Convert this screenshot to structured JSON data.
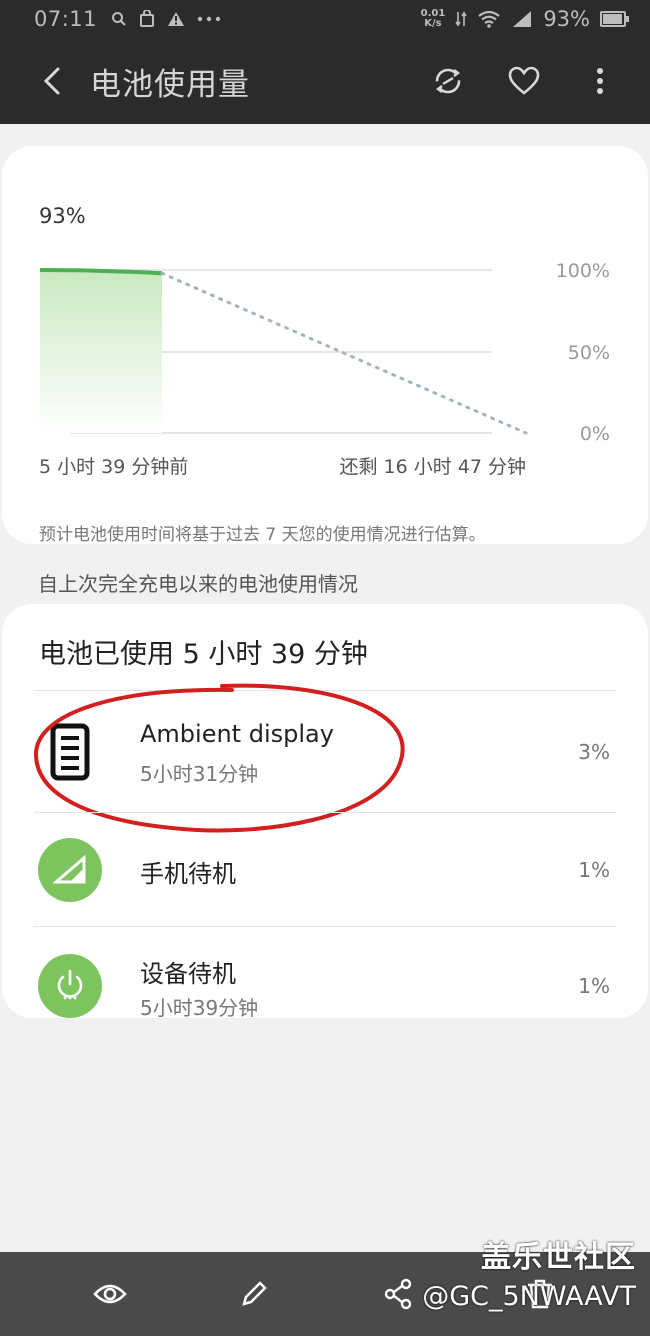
{
  "status_bar": {
    "time": "07:11",
    "speed_top": "0.01",
    "speed_bottom": "K/s",
    "battery": "93%"
  },
  "app_bar": {
    "title": "电池使用量"
  },
  "chart_card": {
    "current_percent": "93%",
    "y_ticks": [
      "100%",
      "50%",
      "0%"
    ],
    "x_left_label": "5 小时 39 分钟前",
    "x_right_label": "还剩 16 小时 47 分钟",
    "note": "预计电池使用时间将基于过去 7 天您的使用情况进行估算。"
  },
  "chart_data": {
    "type": "area",
    "y_ticks": [
      "100%",
      "50%",
      "0%"
    ],
    "ylim": [
      0,
      100
    ],
    "x_labels": [
      "5 小时 39 分钟前",
      "还剩 16 小时 47 分钟"
    ],
    "series": [
      {
        "values": [
          100,
          98
        ]
      },
      {
        "values": [
          98,
          0
        ]
      }
    ],
    "colors": {
      "actual": "#4caf50",
      "projection": "#a5b4bb",
      "fill": "#d6edd0"
    }
  },
  "section_title": "自上次完全充电以来的电池使用情况",
  "usage_card": {
    "total": "电池已使用 5 小时 39 分钟",
    "items": [
      {
        "name": "Ambient display",
        "sub": "5小时31分钟",
        "percent": "3%",
        "icon": "phone-screen-icon"
      },
      {
        "name": "手机待机",
        "sub": "",
        "percent": "1%",
        "icon": "signal-icon"
      },
      {
        "name": "设备待机",
        "sub": "5小时39分钟",
        "percent": "1%",
        "icon": "power-icon"
      }
    ]
  },
  "colors": {
    "accent_green": "#7dc45e",
    "annotation_red": "#d22020"
  },
  "watermark": {
    "line1": "盖乐世社区",
    "line2": "@GC_5NWAAVT"
  }
}
